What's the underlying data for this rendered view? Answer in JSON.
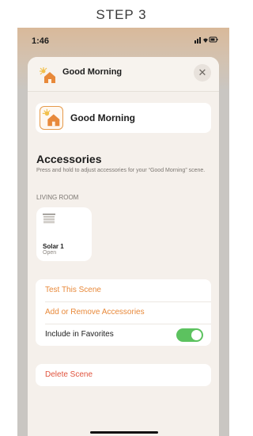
{
  "step_label": "STEP 3",
  "status_bar": {
    "time": "1:46",
    "icons": "▐▐ ▼ ▬"
  },
  "sheet": {
    "title": "Good Morning",
    "close_icon": "✕"
  },
  "scene_card": {
    "name": "Good Morning"
  },
  "accessories": {
    "title": "Accessories",
    "description": "Press and hold to adjust accessories for your “Good Morning” scene.",
    "room_label": "LIVING ROOM",
    "items": [
      {
        "name": "Solar 1",
        "status": "Open",
        "icon": "blinds-icon"
      }
    ]
  },
  "actions": {
    "test_scene": "Test This Scene",
    "add_remove": "Add or Remove Accessories",
    "include_favorites": "Include in Favorites",
    "favorites_enabled": true,
    "delete_scene": "Delete Scene"
  },
  "colors": {
    "accent": "#e8893a",
    "destructive": "#e0533d",
    "toggle_on": "#5cc25f"
  }
}
